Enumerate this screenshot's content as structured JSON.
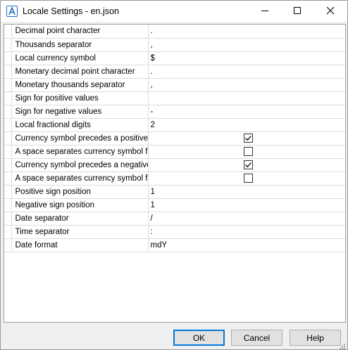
{
  "window": {
    "title": "Locale Settings - en.json",
    "icons": {
      "app": "app-icon-A",
      "minimize": "minimize-icon",
      "maximize": "maximize-icon",
      "close": "close-icon"
    }
  },
  "grid": {
    "rows": [
      {
        "label": "Decimal point character",
        "type": "text",
        "value": "."
      },
      {
        "label": "Thousands separator",
        "type": "text",
        "value": ","
      },
      {
        "label": "Local currency symbol",
        "type": "text",
        "value": "$"
      },
      {
        "label": "Monetary decimal point character",
        "type": "text",
        "value": "."
      },
      {
        "label": "Monetary thousands separator",
        "type": "text",
        "value": ","
      },
      {
        "label": "Sign for positive values",
        "type": "text",
        "value": ""
      },
      {
        "label": "Sign for negative values",
        "type": "text",
        "value": "-"
      },
      {
        "label": "Local fractional digits",
        "type": "text",
        "value": "2"
      },
      {
        "label": "Currency symbol precedes a positive v",
        "type": "checkbox",
        "checked": true
      },
      {
        "label": "A space separates currency symbol fr",
        "type": "checkbox",
        "checked": false
      },
      {
        "label": "Currency symbol precedes a negative",
        "type": "checkbox",
        "checked": true
      },
      {
        "label": "A space separates currency symbol fr",
        "type": "checkbox",
        "checked": false
      },
      {
        "label": "Positive sign position",
        "type": "text",
        "value": "1"
      },
      {
        "label": "Negative sign position",
        "type": "text",
        "value": "1"
      },
      {
        "label": "Date separator",
        "type": "text",
        "value": "/"
      },
      {
        "label": "Time separator",
        "type": "text",
        "value": ":"
      },
      {
        "label": "Date format",
        "type": "text",
        "value": "mdY"
      }
    ]
  },
  "buttons": {
    "ok": "OK",
    "cancel": "Cancel",
    "help": "Help"
  },
  "colors": {
    "accent": "#0078d7",
    "app_icon": "#1f6fc5"
  }
}
